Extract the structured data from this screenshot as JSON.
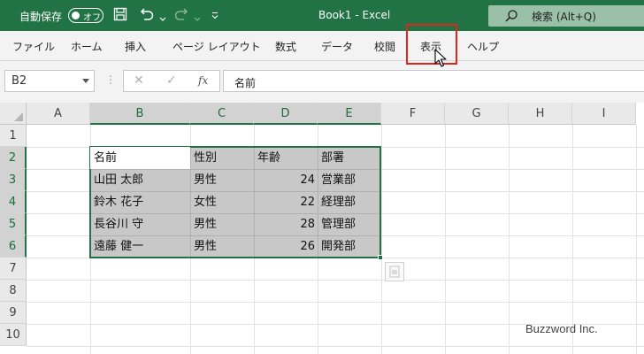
{
  "titlebar": {
    "autosave_label": "自動保存",
    "autosave_state": "オフ",
    "document_title": "Book1  -  Excel",
    "search_placeholder": "検索 (Alt+Q)",
    "bg_color": "#217346"
  },
  "ribbon": {
    "tabs": [
      "ファイル",
      "ホーム",
      "挿入",
      "ページ レイアウト",
      "数式",
      "データ",
      "校閲",
      "表示",
      "ヘルプ"
    ],
    "highlighted_tab": "表示",
    "highlight_color": "#e0261c"
  },
  "formula_bar": {
    "name_box": "B2",
    "dots": "⋮",
    "cancel_symbol": "✕",
    "enter_symbol": "✓",
    "fx_symbol": "fx",
    "content": "名前"
  },
  "grid": {
    "columns": [
      "A",
      "B",
      "C",
      "D",
      "E",
      "F",
      "G",
      "H",
      "I"
    ],
    "rows": [
      "1",
      "2",
      "3",
      "4",
      "5",
      "6",
      "7",
      "8",
      "9",
      "10"
    ],
    "selected_columns": [
      "B",
      "C",
      "D",
      "E"
    ],
    "selected_rows": [
      "2",
      "3",
      "4",
      "5",
      "6"
    ],
    "accent_color": "#217346",
    "table": {
      "headers": [
        "名前",
        "性別",
        "年齢",
        "部署"
      ],
      "rows": [
        [
          "山田 太郎",
          "男性",
          "24",
          "営業部"
        ],
        [
          "鈴木 花子",
          "女性",
          "22",
          "経理部"
        ],
        [
          "長谷川 守",
          "男性",
          "28",
          "管理部"
        ],
        [
          "遠藤 健一",
          "男性",
          "26",
          "開発部"
        ]
      ]
    }
  },
  "watermark": "Buzzword Inc."
}
